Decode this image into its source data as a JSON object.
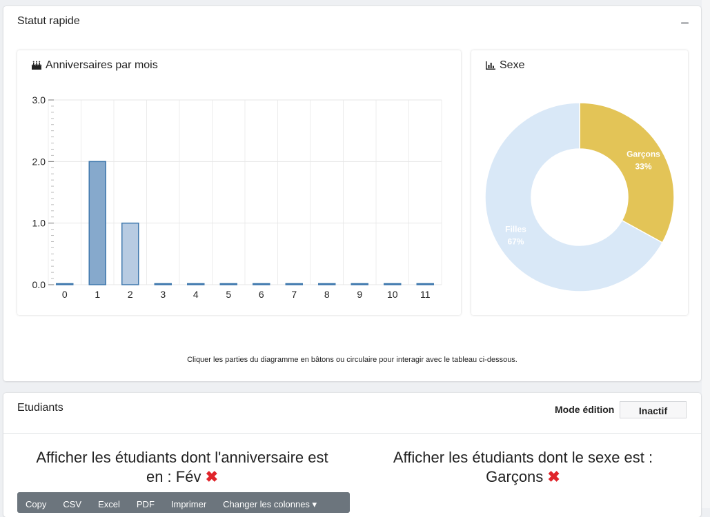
{
  "status_card": {
    "title": "Statut rapide"
  },
  "birthday_chart": {
    "title": "Anniversaires par mois",
    "icon": "birthday-cake-icon"
  },
  "gender_chart": {
    "title": "Sexe",
    "icon": "bar-chart-icon"
  },
  "chart_data": [
    {
      "type": "bar",
      "title": "Anniversaires par mois",
      "categories": [
        "0",
        "1",
        "2",
        "3",
        "4",
        "5",
        "6",
        "7",
        "8",
        "9",
        "10",
        "11"
      ],
      "values": [
        0,
        2,
        1,
        0,
        0,
        0,
        0,
        0,
        0,
        0,
        0,
        0
      ],
      "y_ticks": [
        "0.0",
        "1.0",
        "2.0",
        "3.0"
      ],
      "ylim": [
        0,
        3
      ],
      "grid": true,
      "colors": {
        "default": "#b7cbe2",
        "selected": "#86a9cc",
        "border": "#3f78ad"
      },
      "selected_index": 1
    },
    {
      "type": "pie",
      "title": "Sexe",
      "slices": [
        {
          "label": "Garçons",
          "percent_label": "33%",
          "value": 33,
          "color": "#e3c457"
        },
        {
          "label": "Filles",
          "percent_label": "67%",
          "value": 67,
          "color": "#d9e8f7"
        }
      ],
      "donut": true
    }
  ],
  "hint_text": "Cliquer les parties du diagramme en bâtons ou circulaire pour interagir avec le tableau ci-dessous.",
  "students_card": {
    "title": "Etudiants",
    "edit_mode_label": "Mode édition",
    "edit_mode_value": "Inactif",
    "birthday_filter_line1": "Afficher les étudiants dont l'anniversaire est",
    "birthday_filter_line2": "en : Fév",
    "gender_filter_line1": "Afficher les étudiants dont le sexe est :",
    "gender_filter_line2": "Garçons",
    "remove_glyph": "✖",
    "toolbar": [
      "Copy",
      "CSV",
      "Excel",
      "PDF",
      "Imprimer",
      "Changer les colonnes ▾"
    ]
  }
}
